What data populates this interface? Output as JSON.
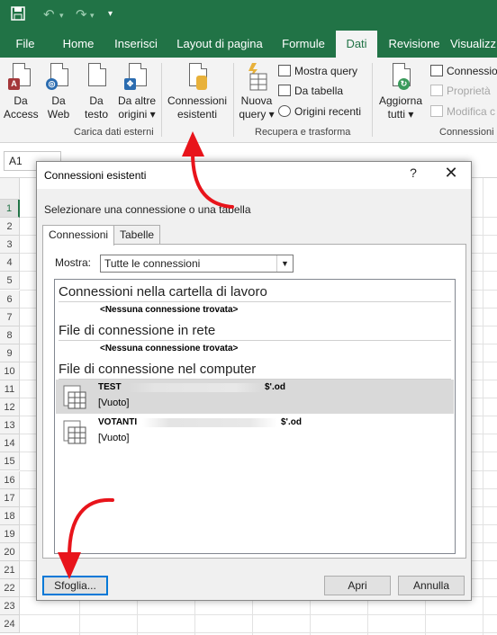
{
  "tabs": [
    "File",
    "Home",
    "Inserisci",
    "Layout di pagina",
    "Formule",
    "Dati",
    "Revisione",
    "Visualizz"
  ],
  "active_tab": "Dati",
  "ribbon": {
    "access": [
      "Da",
      "Access"
    ],
    "web": [
      "Da",
      "Web"
    ],
    "testo": [
      "Da",
      "testo"
    ],
    "altre": [
      "Da altre",
      "origini ▾"
    ],
    "connessioni": [
      "Connessioni",
      "esistenti"
    ],
    "nuova": [
      "Nuova",
      "query ▾"
    ],
    "mostra_query": "Mostra query",
    "da_tabella": "Da tabella",
    "origini_recenti": "Origini recenti",
    "aggiorna": [
      "Aggiorna",
      "tutti ▾"
    ],
    "conn": "Connession",
    "proprieta": "Proprietà",
    "modifica": "Modifica c",
    "group_carica": "Carica dati esterni",
    "group_recupera": "Recupera e trasforma",
    "group_conn": "Connessioni"
  },
  "namebox": "A1",
  "rows": [
    "1",
    "2",
    "3",
    "4",
    "5",
    "6",
    "7",
    "8",
    "9",
    "10",
    "11",
    "12",
    "13",
    "14",
    "15",
    "16",
    "17",
    "18",
    "19",
    "20",
    "21",
    "22",
    "23",
    "24"
  ],
  "dialog": {
    "title": "Connessioni esistenti",
    "help": "?",
    "close": "✕",
    "instruction": "Selezionare una connessione o una tabella",
    "tab_connessioni": "Connessioni",
    "tab_tabelle": "Tabelle",
    "mostra_label": "Mostra:",
    "mostra_value": "Tutte le connessioni",
    "section1": "Connessioni nella cartella di lavoro",
    "none1": "<Nessuna connessione trovata>",
    "section2": "File di connessione in rete",
    "none2": "<Nessuna connessione trovata>",
    "section3": "File di connessione nel computer",
    "items": [
      {
        "name": "TEST",
        "suffix": "$'.od",
        "desc": "[Vuoto]"
      },
      {
        "name": "VOTANTI",
        "suffix": "$'.od",
        "desc": "[Vuoto]"
      }
    ],
    "btn_sfoglia": "Sfoglia...",
    "btn_apri": "Apri",
    "btn_annulla": "Annulla"
  },
  "colors": {
    "excel_green": "#217346",
    "arrow_red": "#e8141b",
    "focus_blue": "#0078d7"
  }
}
